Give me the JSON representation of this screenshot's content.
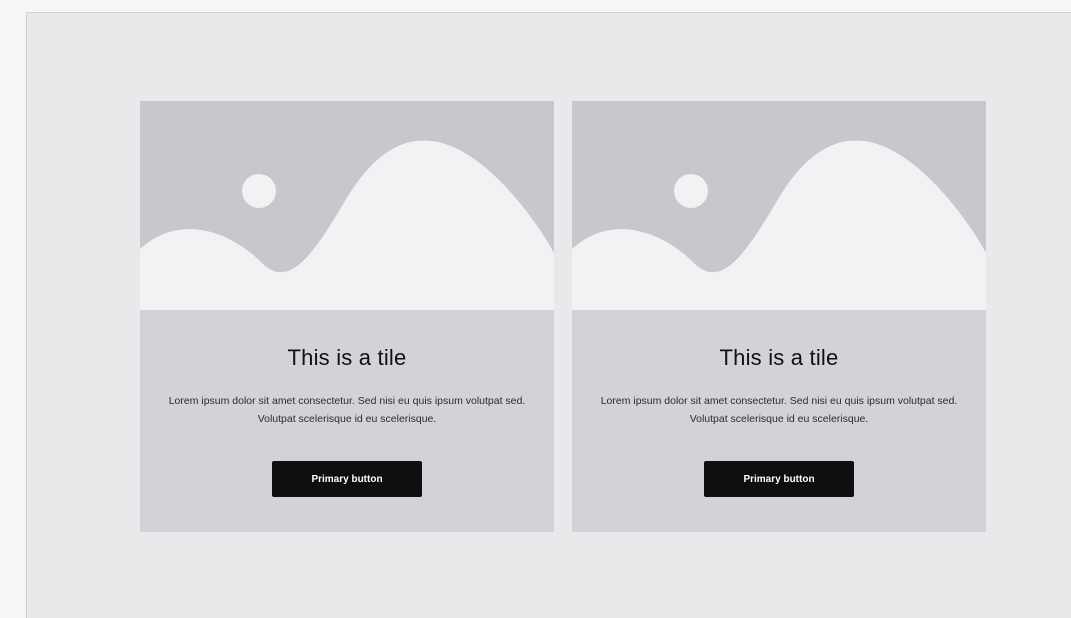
{
  "colors": {
    "page_background": "#f8f6f4",
    "frame_background": "#e9e9ec",
    "tile_background": "#d3d3d7",
    "image_sky": "#c6c8cc",
    "image_ground": "#f2f2f4",
    "button_background": "#0f0f12",
    "button_text": "#ffffff"
  },
  "tiles": [
    {
      "image_icon": "image-placeholder-icon",
      "title": "This is a tile",
      "description": "Lorem ipsum dolor sit amet consectetur. Sed nisi eu quis ipsum volutpat sed. Volutpat scelerisque id eu scelerisque.",
      "button_label": "Primary button"
    },
    {
      "image_icon": "image-placeholder-icon",
      "title": "This is a tile",
      "description": "Lorem ipsum dolor sit amet consectetur. Sed nisi eu quis ipsum volutpat sed. Volutpat scelerisque id eu scelerisque.",
      "button_label": "Primary button"
    }
  ]
}
